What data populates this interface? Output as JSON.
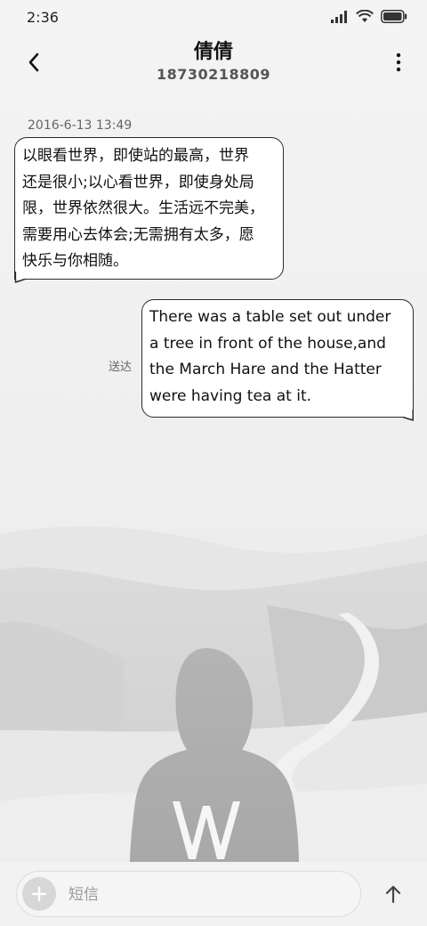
{
  "status_bar": {
    "time": "2:36",
    "icons": [
      "signal-icon",
      "wifi-icon",
      "battery-icon"
    ]
  },
  "header": {
    "back_icon": "chevron-left-icon",
    "contact_name": "倩倩",
    "contact_number": "18730218809",
    "more_icon": "more-vertical-icon"
  },
  "conversation": {
    "timestamp": "2016-6-13 13:49",
    "messages": [
      {
        "direction": "incoming",
        "lines": [
          "以眼看世界，即使站的最高，世界",
          "还是很小;以心看世界，即使身处局",
          "限，世界依然很大。生活远不完美，",
          "需要用心去体会;无需拥有太多，愿",
          "快乐与你相随。"
        ]
      },
      {
        "direction": "outgoing",
        "status": "送达",
        "lines": [
          "There was a table set out under",
          "a tree in front of the house,and",
          "the March Hare and the Hatter",
          "were having tea at it."
        ]
      }
    ]
  },
  "input_bar": {
    "add_icon": "plus-icon",
    "placeholder": "短信",
    "value": "",
    "send_icon": "arrow-up-icon"
  },
  "colors": {
    "bubble_border": "#2b2b2b",
    "bubble_fill": "#ffffff",
    "background": "#efefef"
  }
}
